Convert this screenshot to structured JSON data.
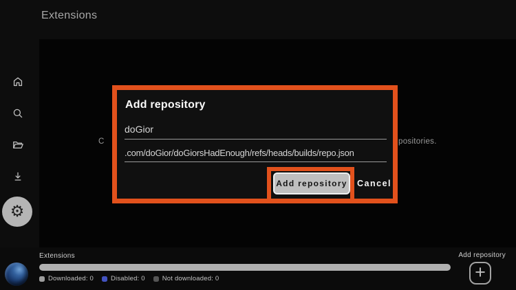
{
  "header": {
    "title": "Extensions"
  },
  "sidebar": {
    "items": [
      {
        "name": "home",
        "icon": "home-icon"
      },
      {
        "name": "search",
        "icon": "search-icon"
      },
      {
        "name": "library",
        "icon": "folder-icon"
      },
      {
        "name": "downloads",
        "icon": "download-icon"
      },
      {
        "name": "settings",
        "icon": "gear-icon",
        "glyph": "⚙",
        "active": true
      }
    ]
  },
  "background_hint": {
    "left_fragment": "C",
    "right_fragment": "positories."
  },
  "dialog": {
    "title": "Add repository",
    "name_field": {
      "value": "doGior"
    },
    "url_field": {
      "value": ".com/doGior/doGiorsHadEnough/refs/heads/builds/repo.json"
    },
    "confirm_label": "Add repository",
    "cancel_label": "Cancel"
  },
  "status_bar": {
    "section_label": "Extensions",
    "legend": [
      {
        "label": "Downloaded: 0",
        "color": "#9e9e9e"
      },
      {
        "label": "Disabled: 0",
        "color": "#4353c0"
      },
      {
        "label": "Not downloaded: 0",
        "color": "#555555"
      }
    ],
    "add_repository_label": "Add repository",
    "plus_glyph": "+"
  },
  "colors": {
    "annotation_orange": "#e2511c",
    "confirm_button_bg": "#bfbfbf",
    "progress_bar": "#b0b0b0",
    "settings_circle": "#b5b5b5"
  }
}
